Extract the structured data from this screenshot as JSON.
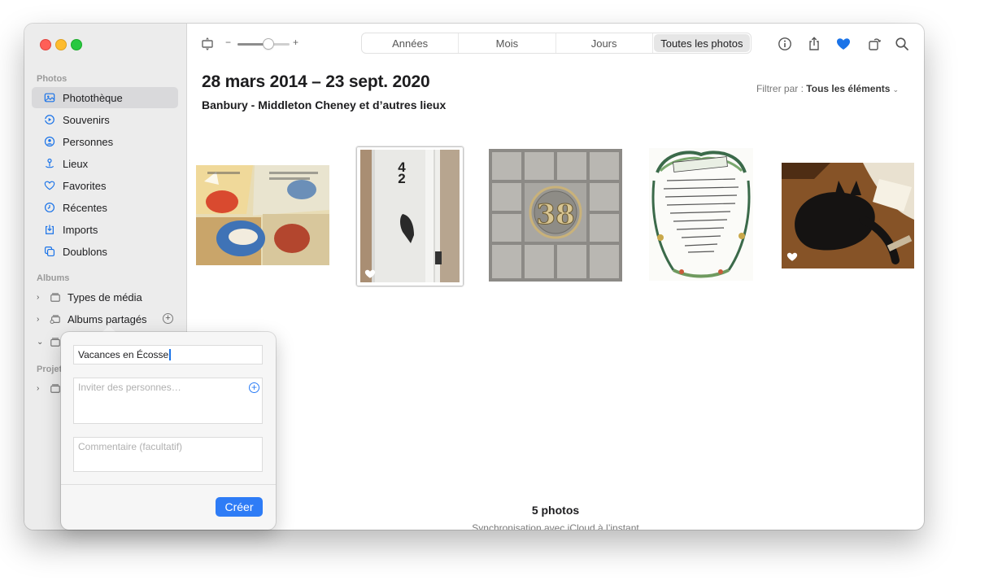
{
  "sidebar": {
    "photos_header": "Photos",
    "items": [
      {
        "label": "Photothèque",
        "icon": "library-icon",
        "selected": true
      },
      {
        "label": "Souvenirs",
        "icon": "memories-icon"
      },
      {
        "label": "Personnes",
        "icon": "people-icon"
      },
      {
        "label": "Lieux",
        "icon": "places-icon"
      },
      {
        "label": "Favorites",
        "icon": "heart-icon"
      },
      {
        "label": "Récentes",
        "icon": "clock-icon"
      },
      {
        "label": "Imports",
        "icon": "import-icon"
      },
      {
        "label": "Doublons",
        "icon": "duplicates-icon"
      }
    ],
    "albums_header": "Albums",
    "albums": [
      {
        "label": "Types de média"
      },
      {
        "label": "Albums partagés"
      }
    ],
    "projects_header": "Projet"
  },
  "toolbar": {
    "zoom_minus": "−",
    "zoom_plus": "+",
    "zoom_level": 0.6,
    "segments": [
      "Années",
      "Mois",
      "Jours",
      "Toutes les photos"
    ],
    "active_segment": "Toutes les photos"
  },
  "content": {
    "date_range": "28 mars 2014 – 23 sept. 2020",
    "location": "Banbury - Middleton Cheney et d’autres lieux",
    "filter_label": "Filtrer par :",
    "filter_value": "Tous les éléments",
    "photo_count": "5 photos",
    "sync_status": "Synchronisation avec iCloud à l’instant",
    "door_number": "42",
    "glass_number": "38"
  },
  "popover": {
    "album_name_value": "Vacances en Écosse",
    "invite_placeholder": "Inviter des personnes…",
    "comment_placeholder": "Commentaire (facultatif)",
    "create_label": "Créer"
  },
  "colors": {
    "accent": "#2e7cf6",
    "favorite_heart": "#1a73e8",
    "close": "#ff5f57",
    "minimize": "#febc2e",
    "zoom": "#28c840"
  }
}
